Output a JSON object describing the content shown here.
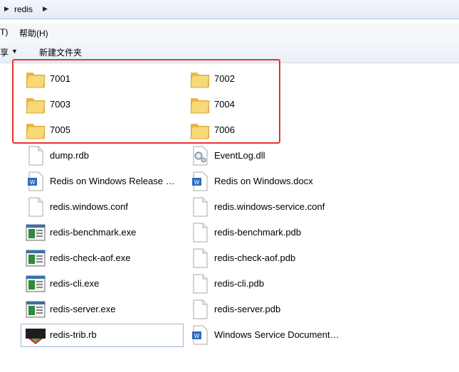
{
  "breadcrumb": {
    "path": "redis"
  },
  "menu": {
    "tools_fragment": "T)",
    "help": "帮助(H)"
  },
  "toolbar": {
    "share_fragment": "享",
    "new_folder": "新建文件夹"
  },
  "files": [
    {
      "name": "7001",
      "icon": "folder-icon"
    },
    {
      "name": "7002",
      "icon": "folder-icon"
    },
    {
      "name": "7003",
      "icon": "folder-icon"
    },
    {
      "name": "7004",
      "icon": "folder-icon"
    },
    {
      "name": "7005",
      "icon": "folder-icon"
    },
    {
      "name": "7006",
      "icon": "folder-icon"
    },
    {
      "name": "dump.rdb",
      "icon": "blank-file-icon"
    },
    {
      "name": "EventLog.dll",
      "icon": "dll-file-icon"
    },
    {
      "name": "Redis on Windows Release N...",
      "icon": "word-doc-icon"
    },
    {
      "name": "Redis on Windows.docx",
      "icon": "word-doc-icon"
    },
    {
      "name": "redis.windows.conf",
      "icon": "blank-file-icon"
    },
    {
      "name": "redis.windows-service.conf",
      "icon": "blank-file-icon"
    },
    {
      "name": "redis-benchmark.exe",
      "icon": "exe-icon"
    },
    {
      "name": "redis-benchmark.pdb",
      "icon": "blank-file-icon"
    },
    {
      "name": "redis-check-aof.exe",
      "icon": "exe-icon"
    },
    {
      "name": "redis-check-aof.pdb",
      "icon": "blank-file-icon"
    },
    {
      "name": "redis-cli.exe",
      "icon": "exe-icon"
    },
    {
      "name": "redis-cli.pdb",
      "icon": "blank-file-icon"
    },
    {
      "name": "redis-server.exe",
      "icon": "exe-icon"
    },
    {
      "name": "redis-server.pdb",
      "icon": "blank-file-icon"
    },
    {
      "name": "redis-trib.rb",
      "icon": "ruby-file-icon"
    },
    {
      "name": "Windows Service Documentati...",
      "icon": "word-doc-icon"
    }
  ],
  "colors": {
    "highlight_box": "#e53333",
    "folder": "#f2cf67"
  }
}
